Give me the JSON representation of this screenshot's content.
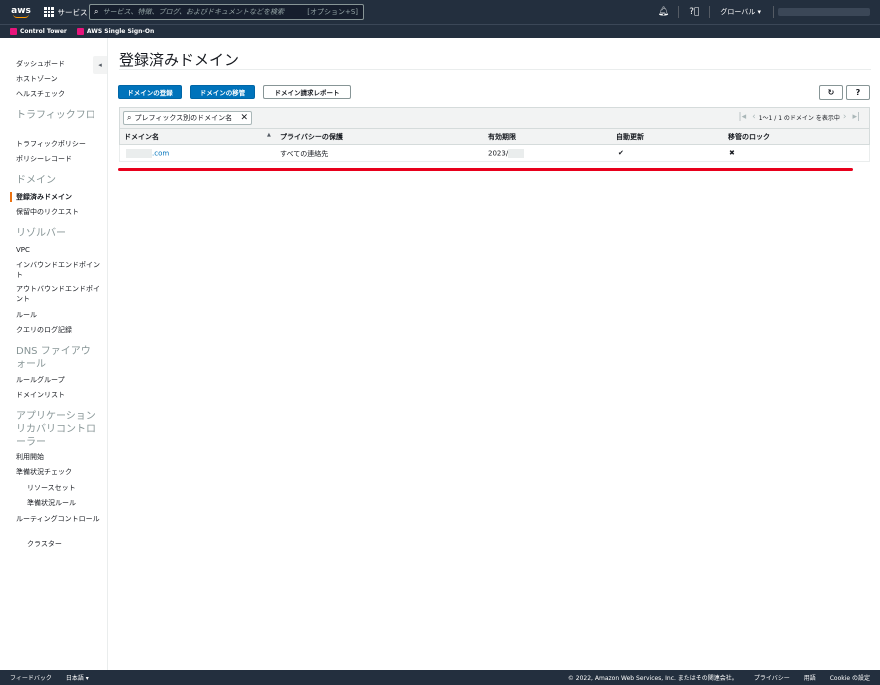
{
  "topnav": {
    "logo": "aws",
    "services_label": "サービス",
    "search_placeholder": "サービス、特徴、ブログ、およびドキュメントなどを検索",
    "search_shortcut": "[オプション+S]",
    "bell_icon": "bell-icon",
    "help_icon": "help-icon",
    "region_label": "グローバル ▾"
  },
  "favorites": [
    {
      "label": "Control Tower",
      "color": "#e7157b"
    },
    {
      "label": "AWS Single Sign-On",
      "color": "#e7157b"
    }
  ],
  "sidebar": {
    "items": [
      {
        "label": "ダッシュボード"
      },
      {
        "label": "ホストゾーン"
      },
      {
        "label": "ヘルスチェック"
      },
      {
        "label": "トラフィックフロー",
        "section": true
      },
      {
        "label": "トラフィックポリシー"
      },
      {
        "label": "ポリシーレコード"
      },
      {
        "label": "ドメイン",
        "section": true
      },
      {
        "label": "登録済みドメイン",
        "active": true
      },
      {
        "label": "保留中のリクエスト"
      },
      {
        "label": "リゾルバー",
        "section": true
      },
      {
        "label": "VPC"
      },
      {
        "label": "インバウンドエンドポイント"
      },
      {
        "label": "アウトバウンドエンドポイント"
      },
      {
        "label": "ルール"
      },
      {
        "label": "クエリのログ記録"
      },
      {
        "label": "DNS ファイアウォール",
        "section": true
      },
      {
        "label": "ルールグループ"
      },
      {
        "label": "ドメインリスト"
      },
      {
        "label": "アプリケーションリカバリコントローラー",
        "section": true
      },
      {
        "label": "利用開始"
      },
      {
        "label": "準備状況チェック"
      },
      {
        "label": "リソースセット",
        "indent": true
      },
      {
        "label": "準備状況ルール",
        "indent": true
      },
      {
        "label": "ルーティングコントロール"
      },
      {
        "label": "クラスター",
        "indent": true
      }
    ]
  },
  "main": {
    "title": "登録済みドメイン",
    "buttons": {
      "register": "ドメインの登録",
      "transfer": "ドメインの移管",
      "billing_report": "ドメイン請求レポート"
    },
    "refresh_icon": "refresh-icon",
    "help_icon": "help-icon",
    "filter_placeholder": "プレフィックス別のドメイン名",
    "pager_text": "1〜1 / 1 のドメイン を表示中",
    "columns": [
      "ドメイン名",
      "プライバシーの保護",
      "有効期限",
      "自動更新",
      "移管のロック"
    ],
    "rows": [
      {
        "domain": ".com",
        "privacy": "すべての連絡先",
        "expiry": "2023/",
        "auto_renew": "✔",
        "transfer_lock": "✖"
      }
    ]
  },
  "footer": {
    "feedback": "フィードバック",
    "language": "日本語 ▾",
    "copyright": "© 2022, Amazon Web Services, Inc. またはその関連会社。",
    "privacy": "プライバシー",
    "terms": "用語",
    "cookie": "Cookie の設定"
  }
}
